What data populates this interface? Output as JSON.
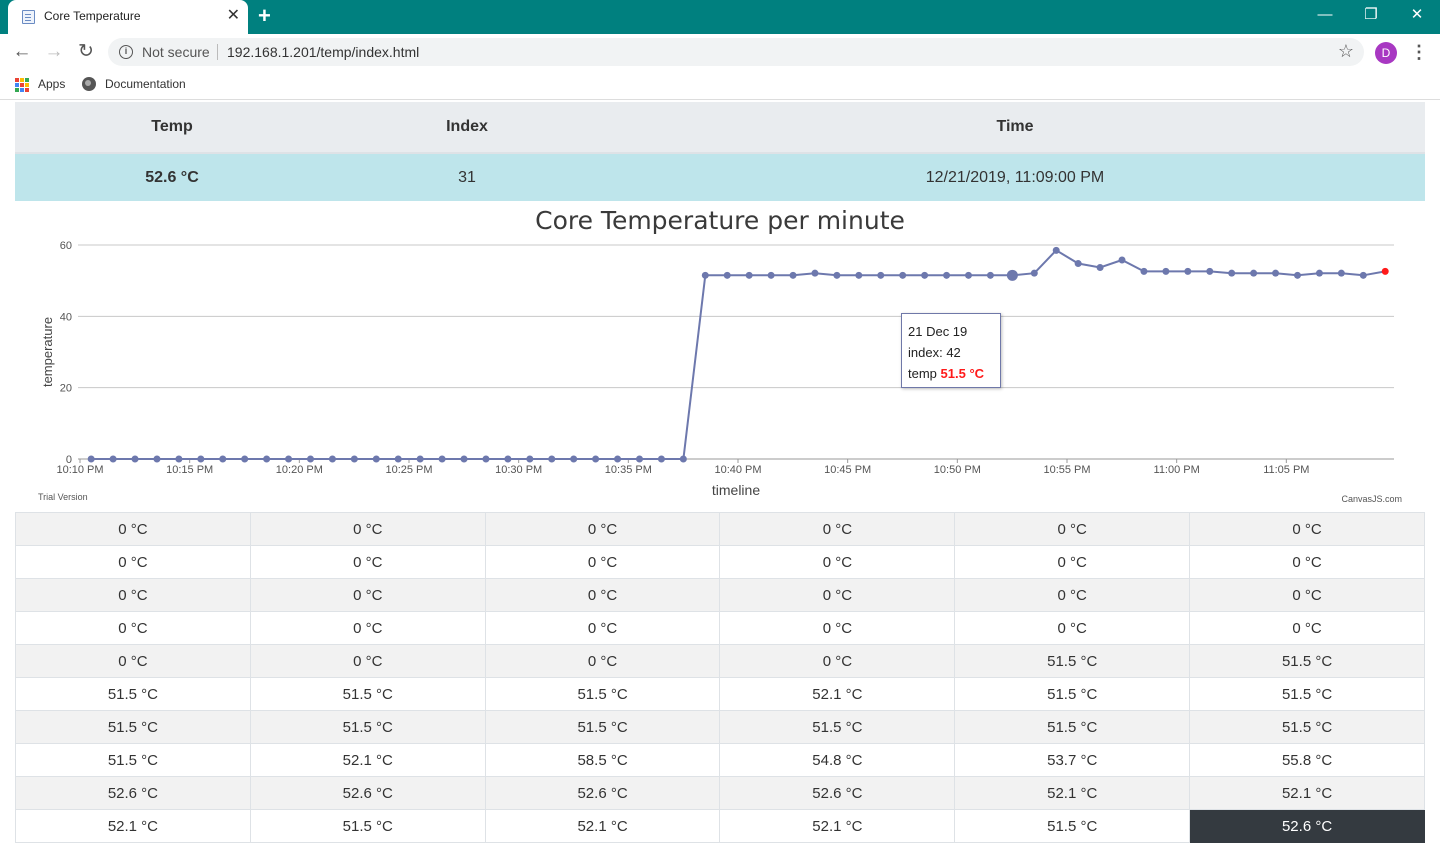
{
  "browser": {
    "tab_title": "Core Temperature",
    "new_tab_glyph": "+",
    "close_tab_glyph": "✕",
    "security_label": "Not secure",
    "url": "192.168.1.201/temp/index.html",
    "avatar_letter": "D",
    "bookmarks": [
      {
        "label": "Apps",
        "icon": "apps-grid-icon"
      },
      {
        "label": "Documentation",
        "icon": "globe-icon"
      }
    ],
    "window_controls": {
      "minimize": "—",
      "maximize": "❐",
      "close": "✕"
    }
  },
  "summary_table": {
    "headers": [
      "Temp",
      "Index",
      "Time"
    ],
    "row": [
      "52.6 °C",
      "31",
      "12/21/2019, 11:09:00 PM"
    ]
  },
  "tooltip": {
    "date": "21 Dec 19",
    "index_label": "index:",
    "index_value": "42",
    "temp_label": "temp",
    "temp_value": "51.5 °C"
  },
  "chart_data": {
    "type": "line",
    "title": "Core Temperature per minute",
    "xlabel": "timeline",
    "ylabel": "temperature",
    "ylim": [
      0,
      60
    ],
    "yticks": [
      0,
      20,
      40,
      60
    ],
    "xticks": [
      "10:10 PM",
      "10:15 PM",
      "10:20 PM",
      "10:25 PM",
      "10:30 PM",
      "10:35 PM",
      "10:40 PM",
      "10:45 PM",
      "10:50 PM",
      "10:55 PM",
      "11:00 PM",
      "11:05 PM"
    ],
    "x_start_time": "10:10 PM",
    "x_interval": "1 minute",
    "values": [
      0,
      0,
      0,
      0,
      0,
      0,
      0,
      0,
      0,
      0,
      0,
      0,
      0,
      0,
      0,
      0,
      0,
      0,
      0,
      0,
      0,
      0,
      0,
      0,
      0,
      0,
      0,
      0,
      51.5,
      51.5,
      51.5,
      51.5,
      51.5,
      52.1,
      51.5,
      51.5,
      51.5,
      51.5,
      51.5,
      51.5,
      51.5,
      51.5,
      51.5,
      52.1,
      58.5,
      54.8,
      53.7,
      55.8,
      52.6,
      52.6,
      52.6,
      52.6,
      52.1,
      52.1,
      52.1,
      51.5,
      52.1,
      52.1,
      51.5,
      52.6
    ],
    "highlight_index": 42,
    "last_point_color": "#ff1a1a",
    "line_color": "#6d78ad",
    "grid": true,
    "watermark_left": "Trial Version",
    "watermark_right": "CanvasJS.com"
  },
  "readings_grid": [
    [
      "0 °C",
      "0 °C",
      "0 °C",
      "0 °C",
      "0 °C",
      "0 °C"
    ],
    [
      "0 °C",
      "0 °C",
      "0 °C",
      "0 °C",
      "0 °C",
      "0 °C"
    ],
    [
      "0 °C",
      "0 °C",
      "0 °C",
      "0 °C",
      "0 °C",
      "0 °C"
    ],
    [
      "0 °C",
      "0 °C",
      "0 °C",
      "0 °C",
      "0 °C",
      "0 °C"
    ],
    [
      "0 °C",
      "0 °C",
      "0 °C",
      "0 °C",
      "51.5 °C",
      "51.5 °C"
    ],
    [
      "51.5 °C",
      "51.5 °C",
      "51.5 °C",
      "52.1 °C",
      "51.5 °C",
      "51.5 °C"
    ],
    [
      "51.5 °C",
      "51.5 °C",
      "51.5 °C",
      "51.5 °C",
      "51.5 °C",
      "51.5 °C"
    ],
    [
      "51.5 °C",
      "52.1 °C",
      "58.5 °C",
      "54.8 °C",
      "53.7 °C",
      "55.8 °C"
    ],
    [
      "52.6 °C",
      "52.6 °C",
      "52.6 °C",
      "52.6 °C",
      "52.1 °C",
      "52.1 °C"
    ],
    [
      "52.1 °C",
      "51.5 °C",
      "52.1 °C",
      "52.1 °C",
      "51.5 °C",
      "52.6 °C"
    ]
  ],
  "active_cell": {
    "row": 9,
    "col": 5
  }
}
